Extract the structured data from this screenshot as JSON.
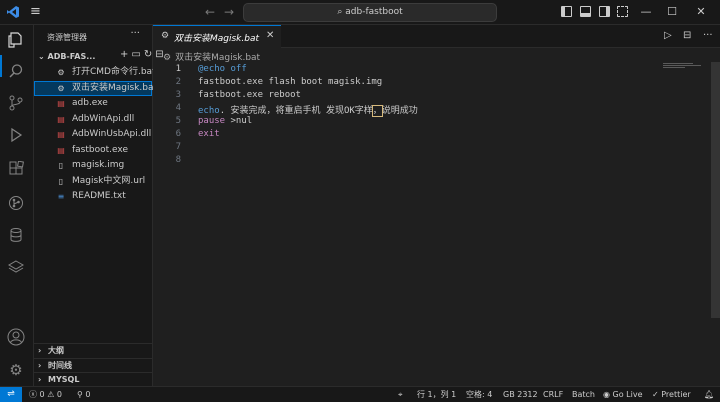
{
  "titlebar": {
    "search_text": "adb-fastboot",
    "icons": [
      "vscode-logo-icon",
      "menu-icon",
      "back-arrow-icon",
      "forward-arrow-icon",
      "search-icon",
      "toggle-sidebar-icon",
      "toggle-panel-icon",
      "toggle-secondary-sidebar-icon",
      "customize-layout-icon",
      "minimize-icon",
      "maximize-icon",
      "close-icon"
    ]
  },
  "activity_bar": {
    "items": [
      "explorer-icon",
      "search-icon",
      "source-control-icon",
      "run-debug-icon",
      "extensions-icon",
      "git-graph-icon",
      "database-icon",
      "stack-icon"
    ],
    "bottom": [
      "account-icon",
      "manage-gear-icon"
    ]
  },
  "sidebar": {
    "title": "资源管理器",
    "more_label": "···",
    "folder_name": "ADB-FAS...",
    "files": [
      {
        "name": "打开CMD命令行.bat",
        "icon": "gear"
      },
      {
        "name": "双击安装Magisk.bat",
        "icon": "gear",
        "selected": true
      },
      {
        "name": "adb.exe",
        "icon": "red"
      },
      {
        "name": "AdbWinApi.dll",
        "icon": "red"
      },
      {
        "name": "AdbWinUsbApi.dll",
        "icon": "red"
      },
      {
        "name": "fastboot.exe",
        "icon": "red"
      },
      {
        "name": "magisk.img",
        "icon": "doc"
      },
      {
        "name": "Magisk中文网.url",
        "icon": "url"
      },
      {
        "name": "README.txt",
        "icon": "txt"
      }
    ],
    "sections": [
      "大纲",
      "时间线",
      "MYSQL"
    ]
  },
  "editor": {
    "tab_label": "双击安装Magisk.bat",
    "breadcrumb": "双击安装Magisk.bat",
    "lines": [
      {
        "n": "1",
        "parts": [
          {
            "t": "@echo off",
            "c": "kw"
          }
        ]
      },
      {
        "n": "2",
        "parts": [
          {
            "t": "fastboot.exe flash boot magisk.img",
            "c": "pl"
          }
        ]
      },
      {
        "n": "3",
        "parts": [
          {
            "t": "fastboot.exe reboot",
            "c": "pl"
          }
        ]
      },
      {
        "n": "4",
        "parts": [
          {
            "t": "echo",
            "c": "kw"
          },
          {
            "t": ". 安装完成，将重启手机 发现OK字样",
            "c": "pl"
          },
          {
            "t": "，",
            "c": "hl"
          },
          {
            "t": "说明成功",
            "c": "pl"
          }
        ]
      },
      {
        "n": "5",
        "parts": [
          {
            "t": "pause",
            "c": "pk"
          },
          {
            "t": " >nul",
            "c": "pl"
          }
        ]
      },
      {
        "n": "6",
        "parts": [
          {
            "t": "exit",
            "c": "pk"
          }
        ]
      },
      {
        "n": "7",
        "parts": []
      },
      {
        "n": "8",
        "parts": []
      }
    ]
  },
  "statusbar": {
    "errors": "0",
    "warnings": "0",
    "ports": "0",
    "position": "行 1，列 1",
    "spaces": "空格: 4",
    "encoding": "GB 2312",
    "eol": "CRLF",
    "language": "Batch",
    "go_live": "Go Live",
    "prettier": "Prettier"
  },
  "colors": {
    "accent": "#0078d4",
    "keyword": "#569cd6",
    "control": "#c586c0",
    "binary_file": "#d44d4d"
  }
}
